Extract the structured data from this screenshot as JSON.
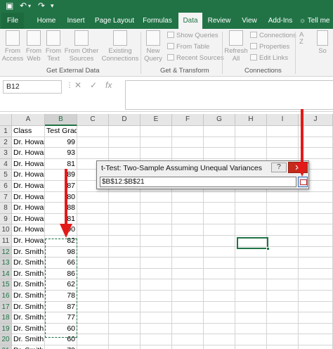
{
  "tabs": [
    "File",
    "Home",
    "Insert",
    "Page Layout",
    "Formulas",
    "Data",
    "Review",
    "View",
    "Add-Ins"
  ],
  "active_tab": "Data",
  "tell_me": "Tell me",
  "ribbon": {
    "from_access": [
      "From",
      "Access"
    ],
    "from_web": [
      "From",
      "Web"
    ],
    "from_text": [
      "From",
      "Text"
    ],
    "from_other": [
      "From Other",
      "Sources"
    ],
    "existing": [
      "Existing",
      "Connections"
    ],
    "new_query": [
      "New",
      "Query"
    ],
    "show_queries": "Show Queries",
    "from_table": "From Table",
    "recent_sources": "Recent Sources",
    "refresh": [
      "Refresh",
      "All"
    ],
    "connections": "Connections",
    "properties": "Properties",
    "edit_links": "Edit Links",
    "sort": [
      "A",
      "Z"
    ],
    "sort_label": "So",
    "group_external": "Get External Data",
    "group_transform": "Get & Transform",
    "group_connections": "Connections"
  },
  "formula_bar": {
    "name_box": "B12",
    "cancel": "✕",
    "enter": "✓",
    "fx": "fx"
  },
  "columns": [
    "A",
    "B",
    "C",
    "D",
    "E",
    "F",
    "G",
    "H",
    "I",
    "J"
  ],
  "rows": [
    [
      "Class",
      "Test Grades"
    ],
    [
      "Dr. Howar",
      "99"
    ],
    [
      "Dr. Howar",
      "93"
    ],
    [
      "Dr. Howar",
      "81"
    ],
    [
      "Dr. Howar",
      "89"
    ],
    [
      "Dr. Howar",
      "87"
    ],
    [
      "Dr. Howar",
      "80"
    ],
    [
      "Dr. Howar",
      "88"
    ],
    [
      "Dr. Howar",
      "81"
    ],
    [
      "Dr. Howar",
      "100"
    ],
    [
      "Dr. Howar",
      "82"
    ],
    [
      "Dr. Smith",
      "98"
    ],
    [
      "Dr. Smith",
      "66"
    ],
    [
      "Dr. Smith",
      "86"
    ],
    [
      "Dr. Smith",
      "62"
    ],
    [
      "Dr. Smith",
      "78"
    ],
    [
      "Dr. Smith",
      "87"
    ],
    [
      "Dr. Smith",
      "77"
    ],
    [
      "Dr. Smith",
      "60"
    ],
    [
      "Dr. Smith",
      "60"
    ],
    [
      "Dr. Smith",
      "79"
    ]
  ],
  "dialog": {
    "title": "t-Test: Two-Sample Assuming Unequal Variances",
    "help": "?",
    "close": "✕",
    "range_value": "$B$12:$B$21"
  },
  "colors": {
    "excel_green": "#217346",
    "arrow_red": "#e21a1a"
  }
}
